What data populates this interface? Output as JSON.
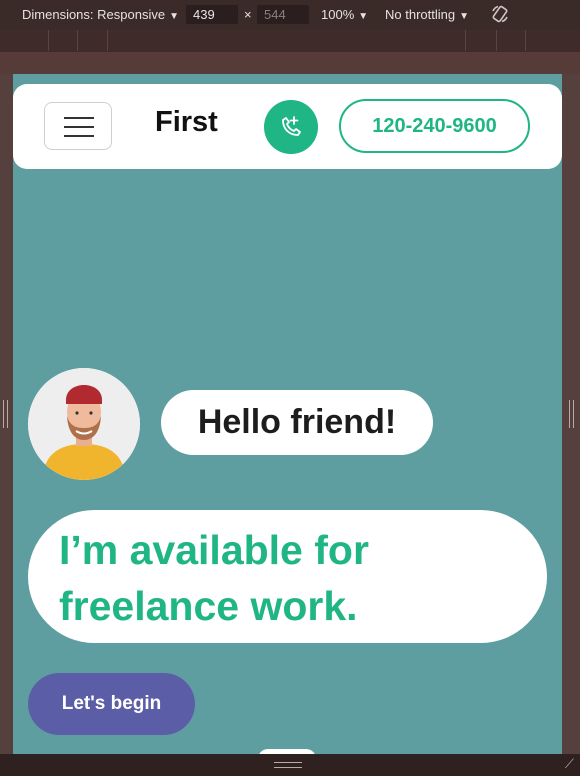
{
  "devtools": {
    "dimensions_label": "Dimensions: Responsive",
    "width_value": "439",
    "times": "×",
    "height_value": "544",
    "zoom": "100%",
    "throttling": "No throttling",
    "rotate_icon": "rotate-icon"
  },
  "site": {
    "brand": "First",
    "phone": "120-240-9600",
    "greeting": "Hello friend!",
    "headline_line1": "I’m available for",
    "headline_line2": "freelance work.",
    "cta": "Let's begin"
  },
  "colors": {
    "page_bg": "#5f9ea0",
    "accent_green": "#1fb584",
    "cta_purple": "#5b5ea6"
  }
}
